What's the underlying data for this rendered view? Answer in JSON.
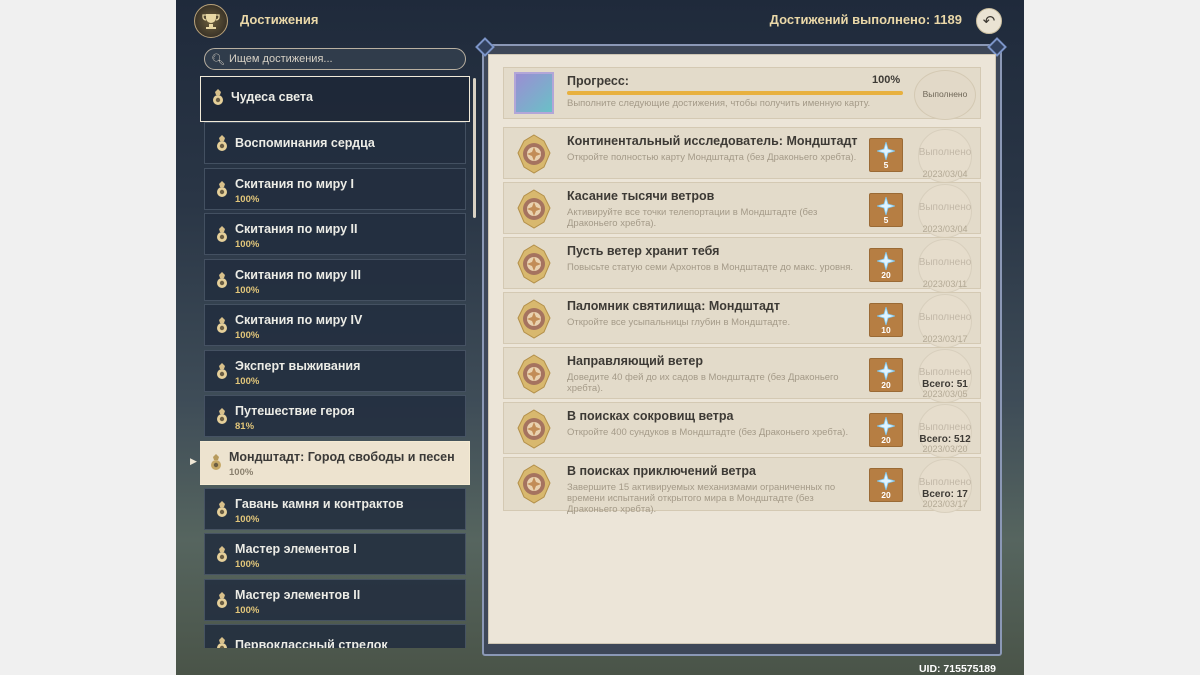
{
  "header": {
    "title": "Достижения",
    "completed": "Достижений выполнено: 1189"
  },
  "search": {
    "placeholder": "Ищем достижения..."
  },
  "categories": [
    {
      "name": "Чудеса света",
      "percent": ""
    },
    {
      "name": "Воспоминания сердца",
      "percent": ""
    },
    {
      "name": "Скитания по миру I",
      "percent": "100%"
    },
    {
      "name": "Скитания по миру II",
      "percent": "100%"
    },
    {
      "name": "Скитания по миру III",
      "percent": "100%"
    },
    {
      "name": "Скитания по миру IV",
      "percent": "100%"
    },
    {
      "name": "Эксперт выживания",
      "percent": "100%"
    },
    {
      "name": "Путешествие героя",
      "percent": "81%"
    },
    {
      "name": "Мондштадт: Город свободы и песен",
      "percent": "100%"
    },
    {
      "name": "Гавань камня и контрактов",
      "percent": "100%"
    },
    {
      "name": "Мастер элементов I",
      "percent": "100%"
    },
    {
      "name": "Мастер элементов II",
      "percent": "100%"
    },
    {
      "name": "Первоклассный стрелок",
      "percent": ""
    }
  ],
  "active_category": 8,
  "progress": {
    "title": "Прогресс:",
    "percent": "100%",
    "value": 1.0,
    "description": "Выполните следующие достижения, чтобы получить именную карту.",
    "stamp": "Выполнено"
  },
  "achievements": [
    {
      "title": "Континентальный исследователь: Мондштадт",
      "description": "Откройте полностью карту Мондштадта (без Драконьего хребта).",
      "reward": "5",
      "status": "Выполнено",
      "total": "",
      "date": "2023/03/04"
    },
    {
      "title": "Касание тысячи ветров",
      "description": "Активируйте все точки телепортации в Мондштадте (без Драконьего хребта).",
      "reward": "5",
      "status": "Выполнено",
      "total": "",
      "date": "2023/03/04"
    },
    {
      "title": "Пусть ветер хранит тебя",
      "description": "Повысьте статую семи Архонтов в Мондштадте до макс. уровня.",
      "reward": "20",
      "status": "Выполнено",
      "total": "",
      "date": "2023/03/11"
    },
    {
      "title": "Паломник святилища: Мондштадт",
      "description": "Откройте все усыпальницы глубин в Мондштадте.",
      "reward": "10",
      "status": "Выполнено",
      "total": "",
      "date": "2023/03/17"
    },
    {
      "title": "Направляющий ветер",
      "description": "Доведите 40 фей до их садов в Мондштадте (без Драконьего хребта).",
      "reward": "20",
      "status": "Выполнено",
      "total": "Всего: 51",
      "date": "2023/03/05"
    },
    {
      "title": "В поисках сокровищ ветра",
      "description": "Откройте 400 сундуков в Мондштадте (без Драконьего хребта).",
      "reward": "20",
      "status": "Выполнено",
      "total": "Всего: 512",
      "date": "2023/03/20"
    },
    {
      "title": "В поисках приключений ветра",
      "description": "Завершите 15 активируемых механизмами ограниченных по времени испытаний открытого мира в Мондштадте (без Драконьего хребта).",
      "reward": "20",
      "status": "Выполнено",
      "total": "Всего: 17",
      "date": "2023/03/17"
    }
  ],
  "uid": "UID: 715575189"
}
